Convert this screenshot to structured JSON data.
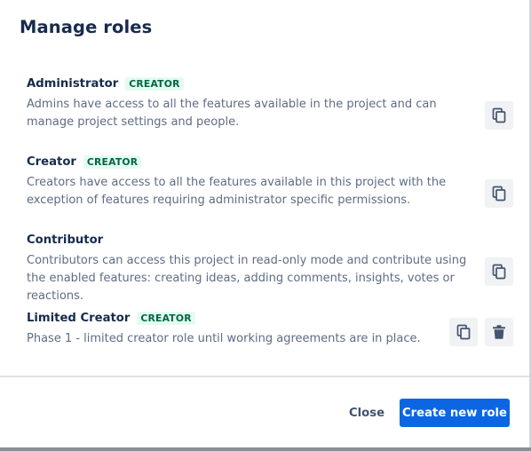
{
  "dialog": {
    "title": "Manage roles"
  },
  "roles": [
    {
      "name": "Administrator",
      "badge": "CREATOR",
      "description": "Admins have access to all the features available in the project and can manage project settings and people.",
      "actions": [
        "copy-icon"
      ]
    },
    {
      "name": "Creator",
      "badge": "CREATOR",
      "description": "Creators have access to all the features available in this project with the exception of features requiring administrator specific permissions.",
      "actions": [
        "copy-icon"
      ]
    },
    {
      "name": "Contributor",
      "badge": "",
      "description": "Contributors can access this project in read-only mode and contribute using the enabled features: creating ideas, adding comments, insights, votes or reactions.",
      "actions": [
        "copy-icon"
      ]
    },
    {
      "name": "Limited Creator",
      "badge": "CREATOR",
      "description": "Phase 1 - limited creator role until working agreements are in place.",
      "actions": [
        "copy-icon",
        "trash-icon"
      ]
    }
  ],
  "footer": {
    "close_label": "Close",
    "create_label": "Create new role"
  },
  "colors": {
    "title": "#172b4d",
    "description": "#5e6c84",
    "badge_bg": "#e3fcef",
    "badge_text": "#006644",
    "icon_button_bg": "#f1f2f4",
    "primary": "#0c66e4"
  }
}
